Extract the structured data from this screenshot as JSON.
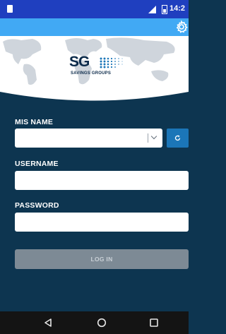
{
  "status_bar": {
    "time": "14:2",
    "icons": [
      "notification-icon",
      "signal-icon",
      "battery-icon"
    ]
  },
  "app_bar": {
    "settings_icon": "gear-icon"
  },
  "logo": {
    "mark": "SG",
    "subtitle": "SAVINGS GROUPS"
  },
  "form": {
    "mis_name": {
      "label": "MIS NAME",
      "value": ""
    },
    "username": {
      "label": "USERNAME",
      "value": "",
      "placeholder": ""
    },
    "password": {
      "label": "PASSWORD",
      "value": "",
      "placeholder": ""
    },
    "login_label": "LOG IN"
  },
  "nav": {
    "icons": [
      "back-icon",
      "home-icon",
      "recents-icon"
    ]
  },
  "colors": {
    "status_bar": "#1f3fbf",
    "app_bar": "#41a9f4",
    "background": "#0d3550",
    "refresh_button": "#1b76b8",
    "login_disabled": "#7d8a95",
    "nav_bar": "#141414"
  }
}
